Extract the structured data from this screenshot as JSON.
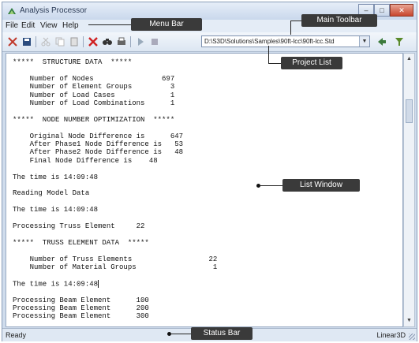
{
  "window": {
    "title": "Analysis Processor"
  },
  "menu": {
    "items": [
      "File",
      "Edit",
      "View",
      "Help"
    ]
  },
  "toolbar": {
    "project_list_value": "D:\\S3D\\Solutions\\Samples\\90ft-lcc\\90ft-lcc.Std"
  },
  "output_lines": [
    "*****  STRUCTURE DATA  *****",
    "",
    "    Number of Nodes                697",
    "    Number of Element Groups         3",
    "    Number of Load Cases             1",
    "    Number of Load Combinations      1",
    "",
    "*****  NODE NUMBER OPTIMIZATION  *****",
    "",
    "    Original Node Difference is      647",
    "    After Phase1 Node Difference is   53",
    "    After Phase2 Node Difference is   48",
    "    Final Node Difference is    48",
    "",
    "The time is 14:09:48",
    "",
    "Reading Model Data",
    "",
    "The time is 14:09:48",
    "",
    "Processing Truss Element     22",
    "",
    "*****  TRUSS ELEMENT DATA  *****",
    "",
    "    Number of Truss Elements                  22",
    "    Number of Material Groups                  1",
    "",
    "The time is 14:09:48",
    "",
    "Processing Beam Element      100",
    "Processing Beam Element      200",
    "Processing Beam Element      300"
  ],
  "status": {
    "left": "Ready",
    "right": "Linear3D"
  },
  "callouts": {
    "menu_bar": "Menu Bar",
    "main_toolbar": "Main Toolbar",
    "project_list": "Project List",
    "list_window": "List Window",
    "status_bar": "Status Bar"
  },
  "colors": {
    "callout_bg": "#3a3a3a",
    "window_frame": "#cfdcec",
    "close_button": "#c8452d"
  }
}
